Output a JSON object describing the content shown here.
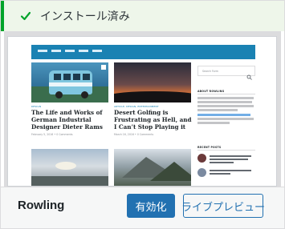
{
  "notice": {
    "icon": "checkmark-icon",
    "text": "インストール済み",
    "accent_color": "#00a32a"
  },
  "preview": {
    "posts": [
      {
        "category": "DESIGN",
        "title": "The Life and Works of German Industrial Designer Dieter Rams",
        "meta": "February 5, 2016 • 0 Comments"
      },
      {
        "category": "ARTICLE, DESIGN, ENTERTAINMENT",
        "title": "Desert Golfing is Frustrating as Hell, and I Can’t Stop Playing it",
        "meta": "March 16, 2016 • 0 Comments"
      }
    ],
    "sidebar": {
      "search_placeholder": "Search Form",
      "about_heading": "ABOUT ROWLING",
      "recent_heading": "RECENT POSTS",
      "recent_posts": [
        "Desert Golfing is Frustrating as Hell, and I Can't Stop Playing it",
        "This is the Title for a Gallery Format Post"
      ]
    },
    "header_color": "#1a82b3"
  },
  "footer": {
    "theme_name": "Rowling",
    "activate_label": "有効化",
    "live_preview_label": "ライブプレビュー",
    "primary_color": "#2271b1"
  }
}
